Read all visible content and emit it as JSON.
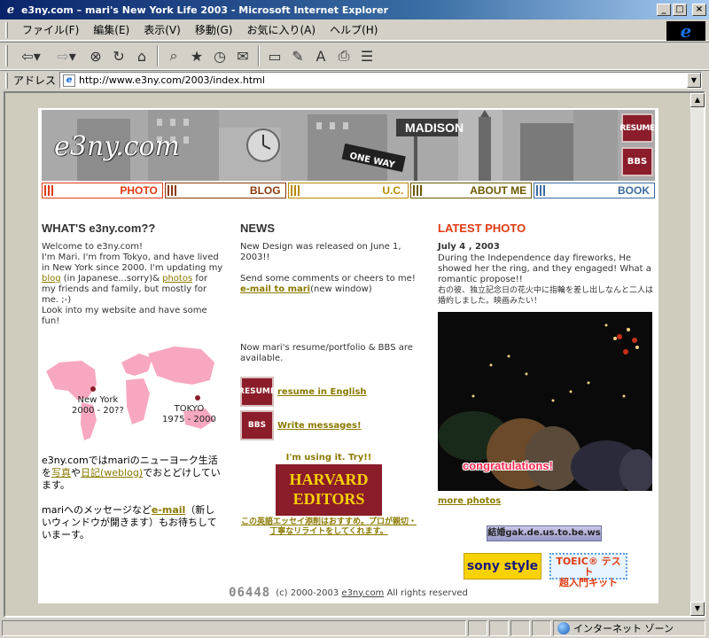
{
  "window": {
    "title": "e3ny.com – mari's New York Life 2003 - Microsoft Internet Explorer",
    "app_icon_letter": "e"
  },
  "menu": [
    "ファイル(F)",
    "編集(E)",
    "表示(V)",
    "移動(G)",
    "お気に入り(A)",
    "ヘルプ(H)"
  ],
  "toolbar": {
    "back_icon": "⇦",
    "forward_icon": "⇨",
    "stop_icon": "⊗",
    "refresh_icon": "↻",
    "home_icon": "⌂",
    "search_icon": "⌕",
    "favorites_icon": "★",
    "history_icon": "◷",
    "mail_icon": "✉",
    "fullscreen_icon": "▭",
    "edit_icon": "✎",
    "font_icon": "A",
    "print_icon": "⎙",
    "notes_icon": "☰"
  },
  "address": {
    "label": "アドレス",
    "url": "http://www.e3ny.com/2003/index.html"
  },
  "banner": {
    "logo": "e3ny.com",
    "resume_label": "RESUME",
    "bbs_label": "BBS",
    "street_sign": "MADISON",
    "one_way": "ONE WAY"
  },
  "nav": [
    {
      "label": "PHOTO",
      "color": "#e03a12"
    },
    {
      "label": "BLOG",
      "color": "#8b3a0a"
    },
    {
      "label": "U.C.",
      "color": "#b88a00"
    },
    {
      "label": "ABOUT ME",
      "color": "#6b5a00"
    },
    {
      "label": "BOOK",
      "color": "#3a6aa0"
    }
  ],
  "whats": {
    "title": "WHAT'S e3ny.com??",
    "intro_1": "Welcome to e3ny.com!",
    "intro_2": "I'm Mari. I'm from Tokyo, and have lived in New York since 2000. I'm updating my",
    "blog_link": "blog",
    "intro_3": "(in Japanese...sorry)&",
    "photos_link": "photos",
    "intro_4": "for my friends and family, but mostly for me. ;-)",
    "intro_5": "Look into my website and have some fun!",
    "map_ny": "New York",
    "map_ny_years": "2000 - 20??",
    "map_tokyo": "TOKYO",
    "map_tokyo_years": "1975 - 2000",
    "jp_1": "e3ny.comではmariのニューヨーク生活を",
    "jp_photo_link": "写真",
    "jp_2": "や",
    "jp_blog_link": "日記",
    "jp_weblog": "(weblog)",
    "jp_3": "でおとどけしています。",
    "jp_4": "mariへのメッセージなど",
    "jp_email_link": "e-mail",
    "jp_5": "（新しいウィンドウが開きます）もお待ちしていまーす。"
  },
  "news": {
    "title": "NEWS",
    "item_1": "New Design was released on June 1, 2003!!",
    "item_2": "Send some comments or cheers to me!",
    "email_link": "e-mail to mari",
    "email_note": "(new window)",
    "item_3": "Now mari's resume/portfolio & BBS are available.",
    "resume_icon_label": "RESUME",
    "resume_link": "resume in English",
    "bbs_icon_label": "BBS",
    "bbs_link": "Write messages!",
    "harvard_caption": "I'm using it. Try!!",
    "harvard_line1": "HARVARD",
    "harvard_line2": "EDITORS",
    "harvard_sub": "この英語エッセイ添削はおすすめ。プロが親切・丁寧なリライトをしてくれます。"
  },
  "latest": {
    "title": "LATEST PHOTO",
    "date": "July 4 , 2003",
    "desc_en": "During the Independence day fireworks, He showed her the ring, and they engaged! What a romantic propose!!",
    "desc_jp": "右の彼、独立記念日の花火中に指輪を差し出しなんと二人は婚約しました。映画みたい！",
    "congrats": "congratulations!",
    "more_link": "more photos"
  },
  "badges": {
    "url_badge": "結婚gak.de.us.to.be.ws",
    "sony": "sony style",
    "toeic_1": "TOEIC® テスト",
    "toeic_2": "超入門キット"
  },
  "footer": {
    "counter": "06448",
    "copyright": "(c) 2000-2003",
    "site_link": "e3ny.com",
    "rights": "All rights reserved"
  },
  "status": {
    "main": "",
    "zone": "インターネット ゾーン"
  }
}
